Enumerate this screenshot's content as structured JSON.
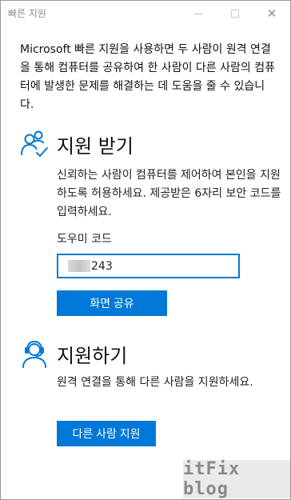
{
  "window": {
    "title": "빠른 지원",
    "controls": {
      "minimize": "minimize",
      "maximize": "maximize",
      "close": "✕"
    }
  },
  "intro": "Microsoft 빠른 지원을 사용하면 두 사람이 원격 연결을 통해 컴퓨터를 공유하여 한 사람이 다른 사람의 컴퓨터에 발생한 문제를 해결하는 데 도움을 줄 수 있습니다.",
  "get_help": {
    "icon": "people-check-icon",
    "title": "지원 받기",
    "description": "신뢰하는 사람이 컴퓨터를 제어하여 본인을 지원하도록 허용하세요. 제공받은 6자리 보안 코드를 입력하세요.",
    "code_label": "도우미 코드",
    "code_value": "243",
    "share_button": "화면 공유"
  },
  "give_help": {
    "icon": "headset-person-icon",
    "title": "지원하기",
    "description": "원격 연결을 통해 다른 사람을 지원하세요.",
    "help_button": "다른 사람 지원"
  },
  "watermark": "itFix blog",
  "colors": {
    "accent": "#0078d7",
    "text": "#111111",
    "title_gray": "#8e8e8e"
  }
}
